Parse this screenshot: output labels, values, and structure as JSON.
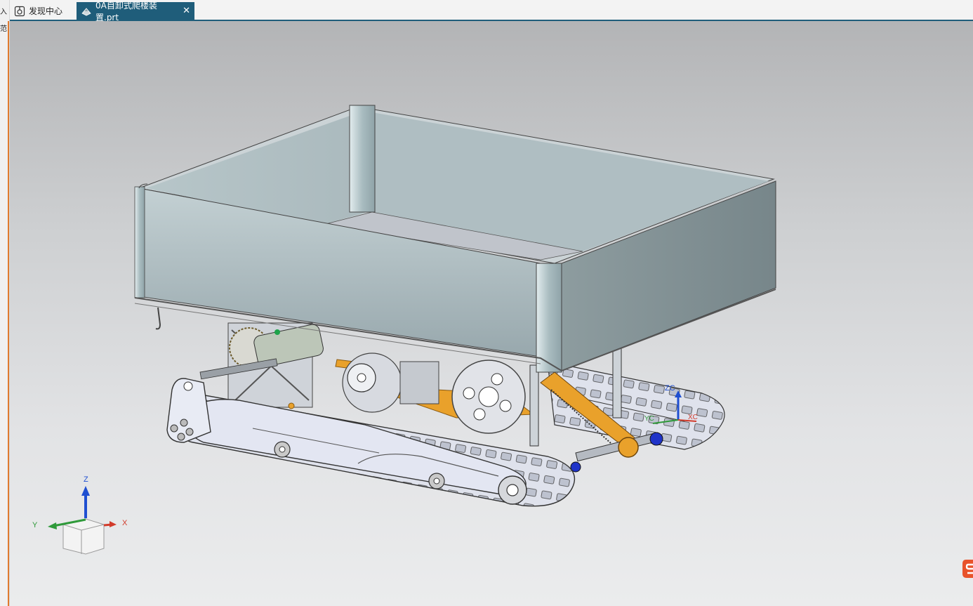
{
  "left_strip": {
    "glyph_top": "入",
    "glyph_mid": "范"
  },
  "tabs": [
    {
      "label": "发现中心",
      "icon": "discovery-icon",
      "active": false
    },
    {
      "label": "0A自卸式爬楼装置.prt",
      "icon": "part-file-icon",
      "active": true,
      "close": "✕"
    }
  ],
  "viewport": {
    "csys_labels": {
      "zc": "ZC",
      "yc": "YC",
      "xc": "XC"
    },
    "triad": {
      "z": "Z",
      "y": "Y",
      "x": "X"
    }
  },
  "colors": {
    "tab_active": "#1f5d7a",
    "hopper": "#9fb1b6",
    "belt": "#e9a12b",
    "track": "#d6d9e4",
    "axis_x": "#d23b2b",
    "axis_y": "#2f9a3a",
    "axis_z": "#1f4fd1",
    "brand": "#e8532b"
  }
}
